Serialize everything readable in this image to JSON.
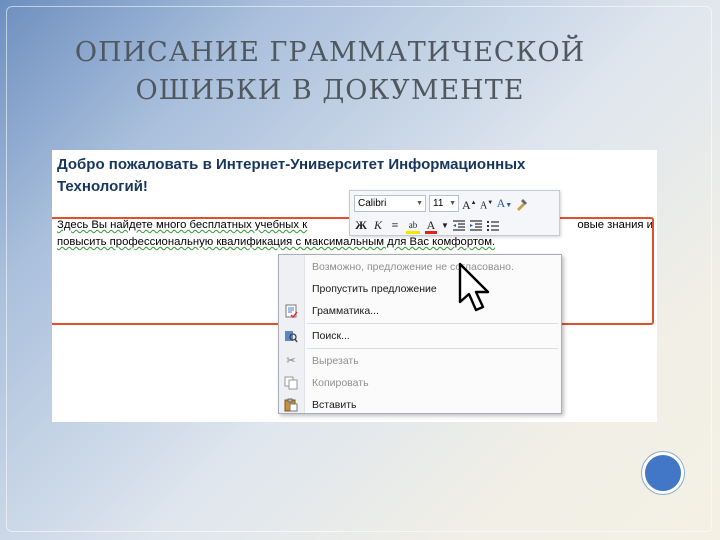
{
  "slide": {
    "title_line1": "ОПИСАНИЕ ГРАММАТИЧЕСКОЙ",
    "title_line2": "ОШИБКИ В ДОКУМЕНТЕ"
  },
  "document": {
    "heading_line1": "Добро пожаловать в Интернет-Университет Информационных",
    "heading_line2": "Технологий!",
    "body_line1_start": "Здесь Вы найдете много бесплатных учебных к",
    "body_line1_end": "овые знания и",
    "body_line2": "повысить профессиональную квалификация с максимальным для Вас комфортом."
  },
  "mini_toolbar": {
    "font_name": "Calibri",
    "font_size": "11",
    "grow_font": "A",
    "shrink_font": "A",
    "styles": "A",
    "bold": "Ж",
    "italic": "К",
    "align": "≡",
    "highlight": "ab",
    "font_color": "A",
    "highlight_color": "#f5e800",
    "font_color_value": "#e02020"
  },
  "context_menu": {
    "items": [
      {
        "label": "Возможно, предложение не согласовано.",
        "icon": "",
        "state": "disabled"
      },
      {
        "label": "Пропустить предложение",
        "icon": "",
        "state": "enabled"
      },
      {
        "label": "Грамматика...",
        "icon": "grammar-icon",
        "state": "enabled"
      },
      {
        "label": "Поиск...",
        "icon": "research-icon",
        "state": "enabled"
      },
      {
        "label": "Вырезать",
        "icon": "scissors-icon",
        "state": "disabled"
      },
      {
        "label": "Копировать",
        "icon": "copy-icon",
        "state": "disabled"
      },
      {
        "label": "Вставить",
        "icon": "paste-icon",
        "state": "enabled"
      }
    ]
  },
  "colors": {
    "highlight_frame": "#e0502a",
    "heading_text": "#17365d",
    "grammar_underline": "#2e9a2e",
    "accent_circle": "#4177c6"
  }
}
